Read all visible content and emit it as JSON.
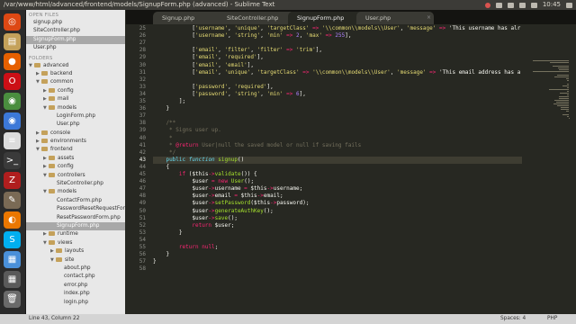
{
  "window": {
    "title": "/var/www/html/advanced/frontend/models/SignupForm.php (advanced) - Sublime Text",
    "clock": "10:45"
  },
  "sidebar": {
    "open_files_header": "OPEN FILES",
    "open_files": [
      "signup.php",
      "SiteController.php",
      "SignupForm.php",
      "User.php"
    ],
    "folders_header": "FOLDERS",
    "tree": [
      {
        "label": "advanced",
        "kind": "folder",
        "depth": 0,
        "open": true
      },
      {
        "label": "backend",
        "kind": "folder",
        "depth": 1,
        "open": false
      },
      {
        "label": "common",
        "kind": "folder",
        "depth": 1,
        "open": true
      },
      {
        "label": "config",
        "kind": "folder",
        "depth": 2,
        "open": false
      },
      {
        "label": "mail",
        "kind": "folder",
        "depth": 2,
        "open": false
      },
      {
        "label": "models",
        "kind": "folder",
        "depth": 2,
        "open": true
      },
      {
        "label": "LoginForm.php",
        "kind": "file",
        "depth": 3
      },
      {
        "label": "User.php",
        "kind": "file",
        "depth": 3
      },
      {
        "label": "console",
        "kind": "folder",
        "depth": 1,
        "open": false
      },
      {
        "label": "environments",
        "kind": "folder",
        "depth": 1,
        "open": false
      },
      {
        "label": "frontend",
        "kind": "folder",
        "depth": 1,
        "open": true
      },
      {
        "label": "assets",
        "kind": "folder",
        "depth": 2,
        "open": false
      },
      {
        "label": "config",
        "kind": "folder",
        "depth": 2,
        "open": false
      },
      {
        "label": "controllers",
        "kind": "folder",
        "depth": 2,
        "open": true
      },
      {
        "label": "SiteController.php",
        "kind": "file",
        "depth": 3
      },
      {
        "label": "models",
        "kind": "folder",
        "depth": 2,
        "open": true
      },
      {
        "label": "ContactForm.php",
        "kind": "file",
        "depth": 3
      },
      {
        "label": "PasswordResetRequestForm",
        "kind": "file",
        "depth": 3
      },
      {
        "label": "ResetPasswordForm.php",
        "kind": "file",
        "depth": 3
      },
      {
        "label": "SignupForm.php",
        "kind": "file",
        "depth": 3,
        "selected": true
      },
      {
        "label": "runtime",
        "kind": "folder",
        "depth": 2,
        "open": false
      },
      {
        "label": "views",
        "kind": "folder",
        "depth": 2,
        "open": true
      },
      {
        "label": "layouts",
        "kind": "folder",
        "depth": 3,
        "open": false
      },
      {
        "label": "site",
        "kind": "folder",
        "depth": 3,
        "open": true
      },
      {
        "label": "about.php",
        "kind": "file",
        "depth": 4
      },
      {
        "label": "contact.php",
        "kind": "file",
        "depth": 4
      },
      {
        "label": "error.php",
        "kind": "file",
        "depth": 4
      },
      {
        "label": "index.php",
        "kind": "file",
        "depth": 4
      },
      {
        "label": "login.php",
        "kind": "file",
        "depth": 4
      }
    ]
  },
  "tabs": [
    {
      "label": "Signup.php",
      "active": false
    },
    {
      "label": "SiteController.php",
      "active": false
    },
    {
      "label": "SignupForm.php",
      "active": true
    },
    {
      "label": "User.php",
      "active": false
    }
  ],
  "editor": {
    "current_line": 43,
    "lines": [
      {
        "n": 25,
        "t": "            ['username', 'unique', 'targetClass' => '\\\\common\\\\models\\\\User', 'message' => 'This username has alr"
      },
      {
        "n": 26,
        "t": "            ['username', 'string', 'min' => 2, 'max' => 255],"
      },
      {
        "n": 27,
        "t": ""
      },
      {
        "n": 28,
        "t": "            ['email', 'filter', 'filter' => 'trim'],"
      },
      {
        "n": 29,
        "t": "            ['email', 'required'],"
      },
      {
        "n": 30,
        "t": "            ['email', 'email'],"
      },
      {
        "n": 31,
        "t": "            ['email', 'unique', 'targetClass' => '\\\\common\\\\models\\\\User', 'message' => 'This email address has a"
      },
      {
        "n": 32,
        "t": ""
      },
      {
        "n": 33,
        "t": "            ['password', 'required'],"
      },
      {
        "n": 34,
        "t": "            ['password', 'string', 'min' => 6],"
      },
      {
        "n": 35,
        "t": "        ];"
      },
      {
        "n": 36,
        "t": "    }"
      },
      {
        "n": 37,
        "t": ""
      },
      {
        "n": 38,
        "t": "    /**"
      },
      {
        "n": 39,
        "t": "     * Signs user up."
      },
      {
        "n": 40,
        "t": "     *"
      },
      {
        "n": 41,
        "t": "     * @return User|null the saved model or null if saving fails"
      },
      {
        "n": 42,
        "t": "     */"
      },
      {
        "n": 43,
        "t": "    public function signup()"
      },
      {
        "n": 44,
        "t": "    {"
      },
      {
        "n": 45,
        "t": "        if ($this->validate()) {"
      },
      {
        "n": 46,
        "t": "            $user = new User();"
      },
      {
        "n": 47,
        "t": "            $user->username = $this->username;"
      },
      {
        "n": 48,
        "t": "            $user->email = $this->email;"
      },
      {
        "n": 49,
        "t": "            $user->setPassword($this->password);"
      },
      {
        "n": 50,
        "t": "            $user->generateAuthKey();"
      },
      {
        "n": 51,
        "t": "            $user->save();"
      },
      {
        "n": 52,
        "t": "            return $user;"
      },
      {
        "n": 53,
        "t": "        }"
      },
      {
        "n": 54,
        "t": ""
      },
      {
        "n": 55,
        "t": "        return null;"
      },
      {
        "n": 56,
        "t": "    }"
      },
      {
        "n": 57,
        "t": "}"
      },
      {
        "n": 58,
        "t": ""
      }
    ]
  },
  "statusbar": {
    "position": "Line 43, Column 22",
    "spaces": "Spaces: 4",
    "syntax": "PHP"
  },
  "launcher_icons": [
    {
      "name": "ubuntu-icon",
      "color": "#dd4814",
      "glyph": "◎"
    },
    {
      "name": "folder-icon",
      "color": "#c4a15a",
      "glyph": "▤"
    },
    {
      "name": "firefox-icon",
      "color": "#e66000",
      "glyph": "●"
    },
    {
      "name": "opera-icon",
      "color": "#cc0f16",
      "glyph": "O"
    },
    {
      "name": "chrome-icon",
      "color": "#4a8e3f",
      "glyph": "◉"
    },
    {
      "name": "chromium-icon",
      "color": "#3c78d8",
      "glyph": "◉"
    },
    {
      "name": "text-editor-icon",
      "color": "#dcdcdc",
      "glyph": "≡"
    },
    {
      "name": "terminal-icon",
      "color": "#3a3a3a",
      "glyph": ">_"
    },
    {
      "name": "filezilla-icon",
      "color": "#b01e1e",
      "glyph": "Z"
    },
    {
      "name": "gimp-icon",
      "color": "#7a6a55",
      "glyph": "✎"
    },
    {
      "name": "blender-icon",
      "color": "#eb7700",
      "glyph": "◐"
    },
    {
      "name": "skype-icon",
      "color": "#00aff0",
      "glyph": "S"
    },
    {
      "name": "app-icon",
      "color": "#4a90d9",
      "glyph": "▦"
    },
    {
      "name": "workspace-icon",
      "color": "#5a5a5a",
      "glyph": "▦"
    },
    {
      "name": "trash-icon",
      "color": "#6a6a6a",
      "glyph": "🗑"
    }
  ]
}
